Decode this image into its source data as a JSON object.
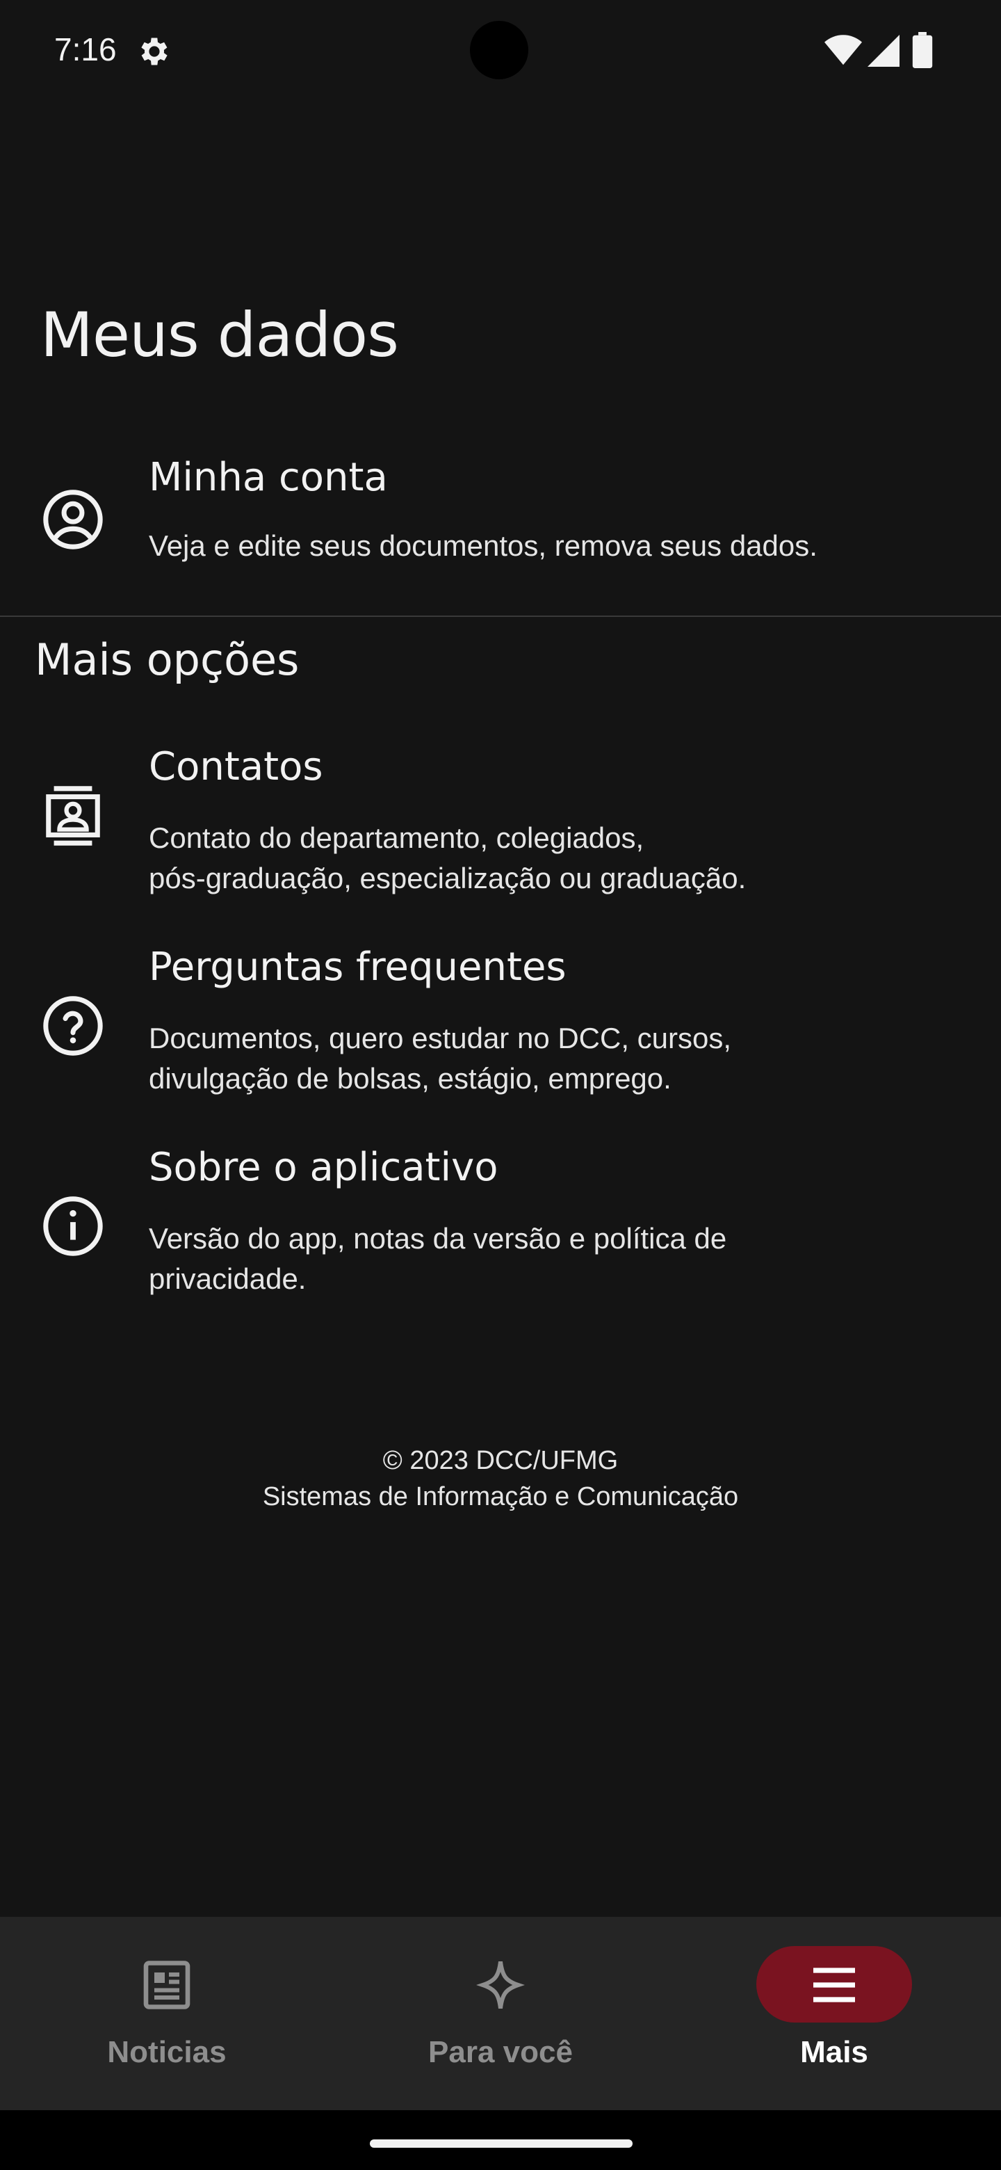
{
  "status_bar": {
    "time": "7:16",
    "icons": [
      "gear-icon",
      "wifi-icon",
      "signal-icon",
      "battery-icon"
    ]
  },
  "page_title": "Meus dados",
  "account_item": {
    "icon": "account-circle-icon",
    "title": "Minha conta",
    "description": "Veja e edite seus documentos, remova seus dados."
  },
  "more_section": {
    "title": "Mais opções",
    "items": [
      {
        "icon": "contacts-icon",
        "title": "Contatos",
        "description_line1": "Contato do departamento, colegiados,",
        "description_line2": "pós-graduação, especialização ou graduação."
      },
      {
        "icon": "help-circle-icon",
        "title": "Perguntas frequentes",
        "description_line1": "Documentos, quero estudar no DCC, cursos,",
        "description_line2": "divulgação de bolsas, estágio, emprego."
      },
      {
        "icon": "info-icon",
        "title": "Sobre o aplicativo",
        "description_line1": "Versão do app, notas da versão e política de",
        "description_line2": "privacidade."
      }
    ]
  },
  "footer": {
    "line1": "© 2023 DCC/UFMG",
    "line2": "Sistemas de Informação e Comunicação"
  },
  "bottom_nav": {
    "accent_color": "#7a1320",
    "items": [
      {
        "label": "Noticias",
        "icon": "newspaper-icon",
        "active": false
      },
      {
        "label": "Para você",
        "icon": "sparkle-icon",
        "active": false
      },
      {
        "label": "Mais",
        "icon": "menu-icon",
        "active": true
      }
    ]
  }
}
